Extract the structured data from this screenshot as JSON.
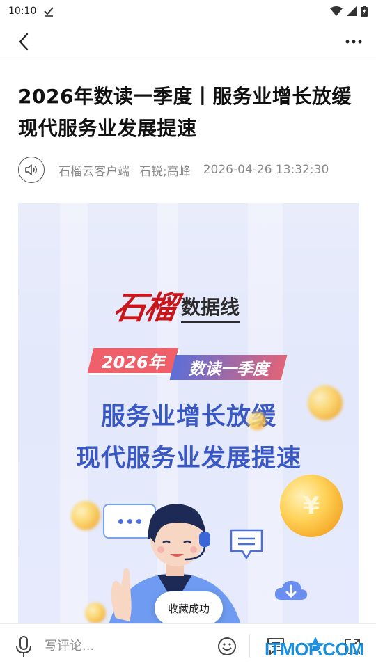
{
  "status_bar": {
    "time": "10:10"
  },
  "article": {
    "title": "2026年数读一季度丨服务业增长放缓 现代服务业发展提速",
    "source": "石榴云客户端",
    "authors": "石锐;高峰",
    "datetime": "2026-04-26 13:32:30"
  },
  "banner": {
    "logo_brand": "石榴",
    "logo_sub": "数据线",
    "year_tag": "2026年",
    "quarter_tag": "数读一季度",
    "headline_line1": "服务业增长放缓",
    "headline_line2": "现代服务业发展提速",
    "coin_symbol": "¥"
  },
  "toast": {
    "text": "收藏成功"
  },
  "bottom_bar": {
    "comment_placeholder": "写评论..."
  },
  "watermark": {
    "text": "ITMOP.COM"
  },
  "colors": {
    "accent_blue": "#3a58c4",
    "brand_red": "#c8161d",
    "favorite_active": "#1a8fe0"
  },
  "icons": [
    "check-icon",
    "wifi-icon",
    "signal-icon",
    "battery-icon",
    "back-arrow-icon",
    "more-dots-icon",
    "speaker-icon",
    "microphone-icon",
    "emoji-icon",
    "comments-icon",
    "star-icon",
    "share-icon"
  ]
}
